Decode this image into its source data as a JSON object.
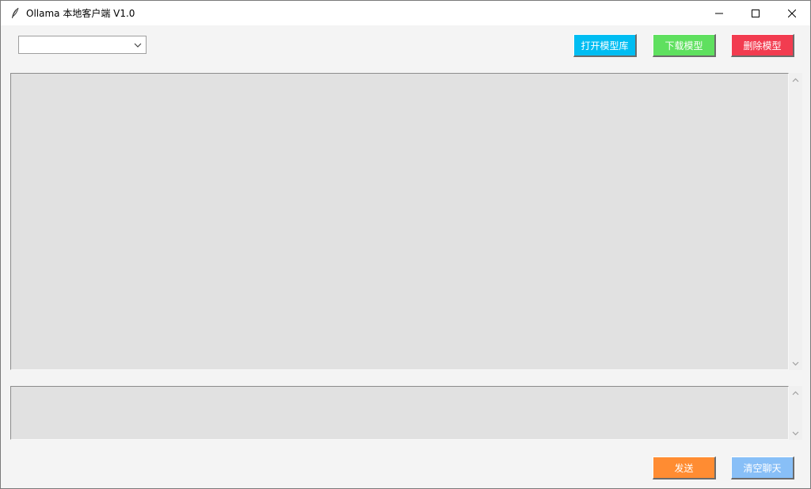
{
  "window": {
    "title": "Ollama 本地客户端 V1.0"
  },
  "toolbar": {
    "model_select_value": "",
    "open_library_label": "打开模型库",
    "download_label": "下载模型",
    "delete_label": "删除模型"
  },
  "chat": {
    "content": ""
  },
  "input": {
    "value": ""
  },
  "actions": {
    "send_label": "发送",
    "clear_label": "清空聊天"
  },
  "colors": {
    "open_library": "#00bdf2",
    "download": "#5fe05f",
    "delete": "#f23c50",
    "send": "#ff8c32",
    "clear": "#88bff7",
    "text_area": "#e1e1e1"
  },
  "icons": {
    "app": "feather-icon",
    "minimize": "minimize-icon",
    "maximize": "maximize-icon",
    "close": "close-icon",
    "dropdown": "chevron-down-icon",
    "scroll_up": "chevron-up-icon",
    "scroll_down": "chevron-down-icon"
  }
}
